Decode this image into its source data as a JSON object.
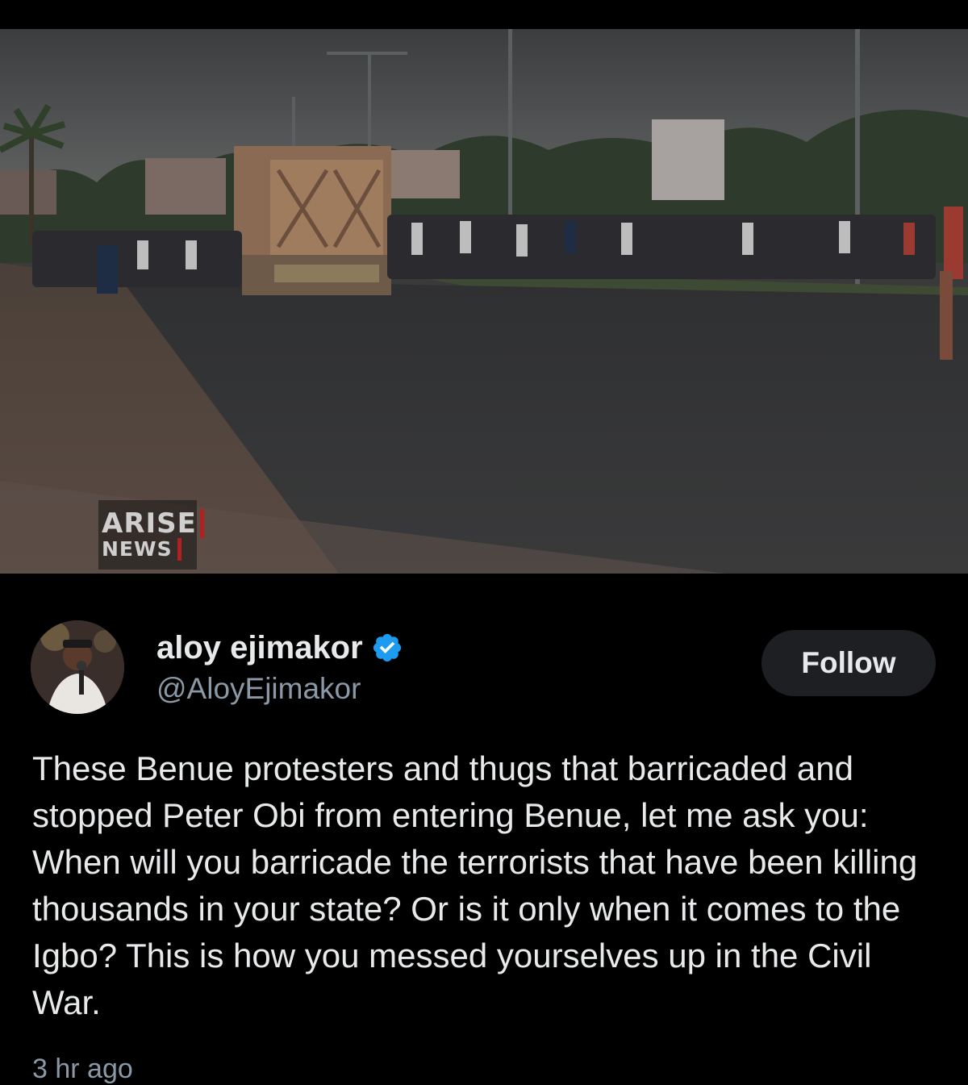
{
  "media": {
    "watermark_line1": "ARISE",
    "watermark_line2": "NEWS",
    "accent_color": "#b32020"
  },
  "post": {
    "author": {
      "display_name": "aloy ejimakor",
      "handle": "@AloyEjimakor",
      "verified": true,
      "verified_icon": "verified-badge-icon",
      "verified_color": "#1d9bf0"
    },
    "follow_label": "Follow",
    "text": "These Benue protesters and thugs that barricaded and stopped Peter Obi from entering Benue, let me ask you: When will you barricade the terrorists that have been killing thousands in your state? Or is it only when it comes to the Igbo? This is how you messed yourselves up in the Civil War.",
    "timestamp": "3 hr ago"
  },
  "colors": {
    "background": "#000000",
    "text_primary": "#e7e9ea",
    "text_secondary": "#8b98a5",
    "button_bg": "#1d1f23"
  }
}
